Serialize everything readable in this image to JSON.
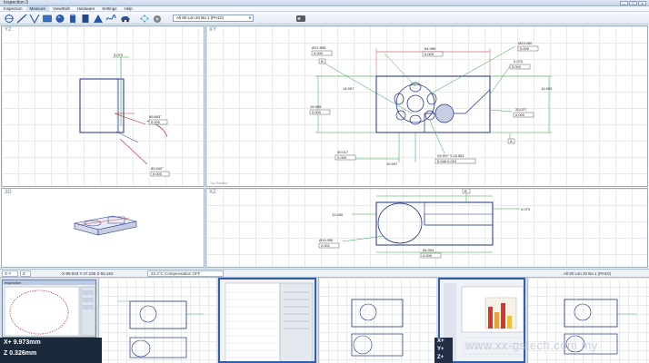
{
  "window": {
    "title": "Inspection 3"
  },
  "menu": [
    "Inspection",
    "Measure",
    "View/Edit",
    "Hardware",
    "Settings",
    "Help"
  ],
  "toolbar": {
    "icons": [
      "circle-tool-icon",
      "line-tool-icon",
      "angle-tool-icon",
      "rectangle-tool-icon",
      "cylinder-tool-icon",
      "cone-tool-icon",
      "curve-tool-icon",
      "car-icon",
      "measure-icon",
      "probe-icon",
      "bird-icon"
    ],
    "probe_select": "All 80 Lsn 20 Ba 1 (PH10)"
  },
  "views": {
    "yz": "YZ",
    "xy": "XY",
    "three_d": "3D",
    "xz": "XZ",
    "xy_sublabel": "Top Rotated"
  },
  "yz_dims": [
    "3.070",
    "89.893°",
    "0.000",
    "89.940°",
    "0.000"
  ],
  "xy_dims": {
    "top_left": [
      "Ø12.595",
      "0.000"
    ],
    "top_mid": [
      "54.965",
      "0.009"
    ],
    "top_right": [
      "Ø23.080",
      "0.000"
    ],
    "right_small": [
      "0.070",
      "0.000"
    ],
    "left": "14.997",
    "right": "14.993",
    "left_lower": [
      "15.995",
      "0.000"
    ],
    "right_lower": [
      "20.027",
      "0.000"
    ],
    "bottom_left": [
      "30.017",
      "0.000"
    ],
    "bottom_mid": "19.997",
    "bottom_right": [
      "X0.997 Y-15.061",
      "0.048  0.019"
    ],
    "tags": [
      "B",
      "A",
      "B"
    ]
  },
  "xz_dims": [
    "12.000",
    "Ø19.996",
    "0.001",
    "54.994",
    "0.000",
    "0.070"
  ],
  "statusbar": {
    "coords": "X-99.943 Y-47.236 Z-55.153",
    "compensation": "22.4°C  Compensation OFF",
    "left_tabs": [
      "X-Y",
      "Z"
    ],
    "right_probe": "All 80 Lsn 20 Ba 1 (PH10)"
  },
  "popup": {
    "title": "Inspection"
  },
  "readout": {
    "x": "X+  9.973mm",
    "z": "Z   0.326mm"
  },
  "axis_panel": [
    "X+",
    "Y+",
    "Z+"
  ],
  "watermark": "www.xx-gstech.com.my"
}
